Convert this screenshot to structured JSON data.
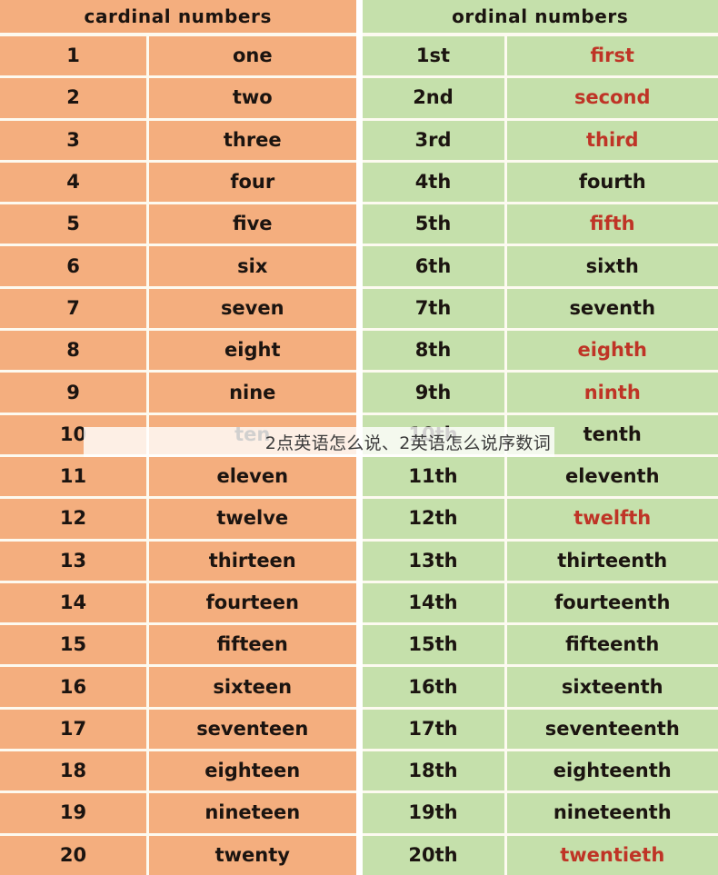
{
  "cardinal_table": {
    "header": "cardinal numbers",
    "background_color": "#f4ae7e",
    "rows": [
      {
        "number": "1",
        "word": "one"
      },
      {
        "number": "2",
        "word": "two"
      },
      {
        "number": "3",
        "word": "three"
      },
      {
        "number": "4",
        "word": "four"
      },
      {
        "number": "5",
        "word": "five"
      },
      {
        "number": "6",
        "word": "six"
      },
      {
        "number": "7",
        "word": "seven"
      },
      {
        "number": "8",
        "word": "eight"
      },
      {
        "number": "9",
        "word": "nine"
      },
      {
        "number": "10",
        "word": "ten"
      },
      {
        "number": "11",
        "word": "eleven"
      },
      {
        "number": "12",
        "word": "twelve"
      },
      {
        "number": "13",
        "word": "thirteen"
      },
      {
        "number": "14",
        "word": "fourteen"
      },
      {
        "number": "15",
        "word": "fifteen"
      },
      {
        "number": "16",
        "word": "sixteen"
      },
      {
        "number": "17",
        "word": "seventeen"
      },
      {
        "number": "18",
        "word": "eighteen"
      },
      {
        "number": "19",
        "word": "nineteen"
      },
      {
        "number": "20",
        "word": "twenty"
      }
    ]
  },
  "ordinal_table": {
    "header": "ordinal numbers",
    "background_color": "#c5e0ab",
    "highlight_color": "#bf3426",
    "rows": [
      {
        "number": "1st",
        "word": "first",
        "highlight": true
      },
      {
        "number": "2nd",
        "word": "second",
        "highlight": true
      },
      {
        "number": "3rd",
        "word": "third",
        "highlight": true
      },
      {
        "number": "4th",
        "word": "fourth",
        "highlight": false
      },
      {
        "number": "5th",
        "word": "fifth",
        "highlight": true
      },
      {
        "number": "6th",
        "word": "sixth",
        "highlight": false
      },
      {
        "number": "7th",
        "word": "seventh",
        "highlight": false
      },
      {
        "number": "8th",
        "word": "eighth",
        "highlight": true
      },
      {
        "number": "9th",
        "word": "ninth",
        "highlight": true
      },
      {
        "number": "10th",
        "word": "tenth",
        "highlight": false
      },
      {
        "number": "11th",
        "word": "eleventh",
        "highlight": false
      },
      {
        "number": "12th",
        "word": "twelfth",
        "highlight": true
      },
      {
        "number": "13th",
        "word": "thirteenth",
        "highlight": false
      },
      {
        "number": "14th",
        "word": "fourteenth",
        "highlight": false
      },
      {
        "number": "15th",
        "word": "fifteenth",
        "highlight": false
      },
      {
        "number": "16th",
        "word": "sixteenth",
        "highlight": false
      },
      {
        "number": "17th",
        "word": "seventeenth",
        "highlight": false
      },
      {
        "number": "18th",
        "word": "eighteenth",
        "highlight": false
      },
      {
        "number": "19th",
        "word": "nineteenth",
        "highlight": false
      },
      {
        "number": "20th",
        "word": "twentieth",
        "highlight": true
      }
    ]
  },
  "overlay": {
    "text": "2点英语怎么说、2英语怎么说序数词"
  }
}
